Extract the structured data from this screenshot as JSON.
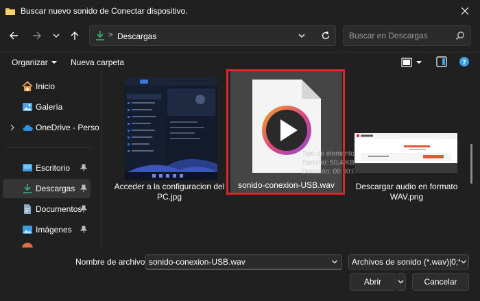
{
  "window": {
    "title": "Buscar nuevo sonido de Conectar dispositivo."
  },
  "nav": {
    "breadcrumb_separator": ">",
    "address": "Descargas",
    "search_placeholder": "Buscar en Descargas"
  },
  "toolbar": {
    "organize_label": "Organizar",
    "new_folder_label": "Nueva carpeta"
  },
  "sidebar": {
    "items": [
      {
        "label": "Inicio",
        "icon": "home-icon",
        "pinned": false
      },
      {
        "label": "Galería",
        "icon": "gallery-icon",
        "pinned": false
      },
      {
        "label": "OneDrive - Perso",
        "icon": "cloud-icon",
        "pinned": false
      },
      {
        "label": "Escritorio",
        "icon": "desktop-icon",
        "pinned": true
      },
      {
        "label": "Descargas",
        "icon": "download-icon",
        "pinned": true,
        "selected": true
      },
      {
        "label": "Documentos",
        "icon": "documents-icon",
        "pinned": true
      },
      {
        "label": "Imágenes",
        "icon": "images-icon",
        "pinned": true
      }
    ]
  },
  "files": [
    {
      "name": "Acceder a la configuracion del PC.jpg",
      "line1": "Acceder a la configuracion del",
      "line2": "PC.jpg",
      "kind": "image-settings"
    },
    {
      "name": "sonido-conexion-USB.wav",
      "line1": "sonido-conexion-USB.wav",
      "line2": "",
      "kind": "audio",
      "selected": true
    },
    {
      "name": "Descargar audio en formato WAV.png",
      "line1": "Descargar audio en formato",
      "line2": "WAV.png",
      "kind": "image-web"
    }
  ],
  "tooltip": {
    "line1": "Tipo de elemento: Archivo WAV",
    "line2": "Tamaño: 50,4 KB",
    "line3": "Duración: 00:00:01"
  },
  "thumb_text": {
    "web_heading": "¡Conversión completada!"
  },
  "footer": {
    "filename_label": "Nombre de archivo:",
    "filename_value": "sonido-conexion-USB.wav",
    "filetype_value": "Archivos de sonido (*.wav)|0;*.w",
    "open_label": "Abrir",
    "cancel_label": "Cancelar"
  },
  "colors": {
    "background": "#202020",
    "selection_border": "#e0242b",
    "accent": "#3aa0e6",
    "download_green": "#3bb27a"
  }
}
